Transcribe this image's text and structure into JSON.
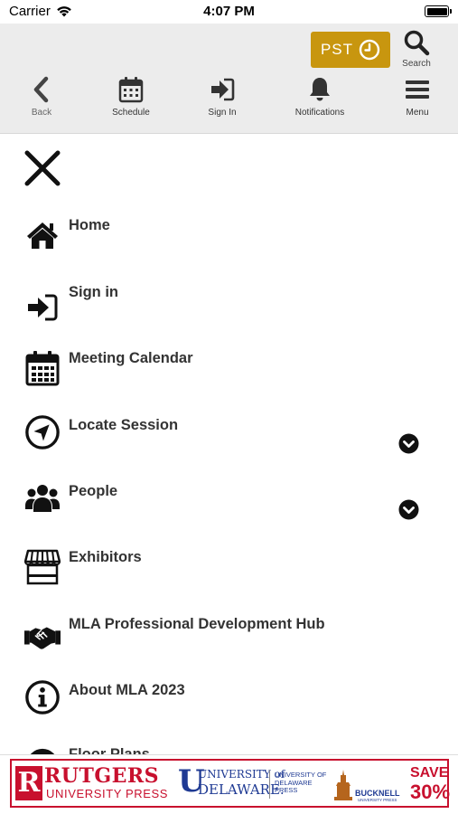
{
  "status_bar": {
    "carrier": "Carrier",
    "time": "4:07 PM"
  },
  "header": {
    "timezone_label": "PST",
    "search_label": "Search",
    "nav": [
      {
        "label": "Back",
        "icon": "chevron-left-icon"
      },
      {
        "label": "Schedule",
        "icon": "calendar-icon"
      },
      {
        "label": "Sign In",
        "icon": "sign-in-icon"
      },
      {
        "label": "Notifications",
        "icon": "bell-icon"
      },
      {
        "label": "Menu",
        "icon": "hamburger-icon"
      }
    ]
  },
  "menu": {
    "items": [
      {
        "label": "Home",
        "icon": "home-icon",
        "expandable": false
      },
      {
        "label": "Sign in",
        "icon": "sign-in-icon",
        "expandable": false
      },
      {
        "label": "Meeting Calendar",
        "icon": "calendar-icon",
        "expandable": false
      },
      {
        "label": "Locate Session",
        "icon": "location-arrow-icon",
        "expandable": true
      },
      {
        "label": "People",
        "icon": "users-icon",
        "expandable": true
      },
      {
        "label": "Exhibitors",
        "icon": "storefront-icon",
        "expandable": false
      },
      {
        "label": "MLA Professional Development Hub",
        "icon": "handshake-icon",
        "expandable": false
      },
      {
        "label": "About MLA 2023",
        "icon": "info-icon",
        "expandable": false
      },
      {
        "label": "Floor Plans",
        "icon": "map-icon",
        "expandable": false
      }
    ]
  },
  "ad": {
    "rutgers_letter": "R",
    "rutgers": "RUTGERS",
    "rutgers_press": "UNIVERSITY PRESS",
    "ud_mark": "U",
    "ud_line1": "UNIVERSITY of",
    "ud_line2": "DELAWARE.",
    "ud_press": "UNIVERSITY OF DELAWARE PRESS",
    "bucknell": "BUCKNELL",
    "bucknell_sub": "UNIVERSITY PRESS",
    "save": "SAVE",
    "percent": "30%"
  },
  "colors": {
    "accent": "#c8960f",
    "header_bg": "#ececec",
    "ad_red": "#c8102e",
    "ad_blue": "#1f3a93"
  }
}
